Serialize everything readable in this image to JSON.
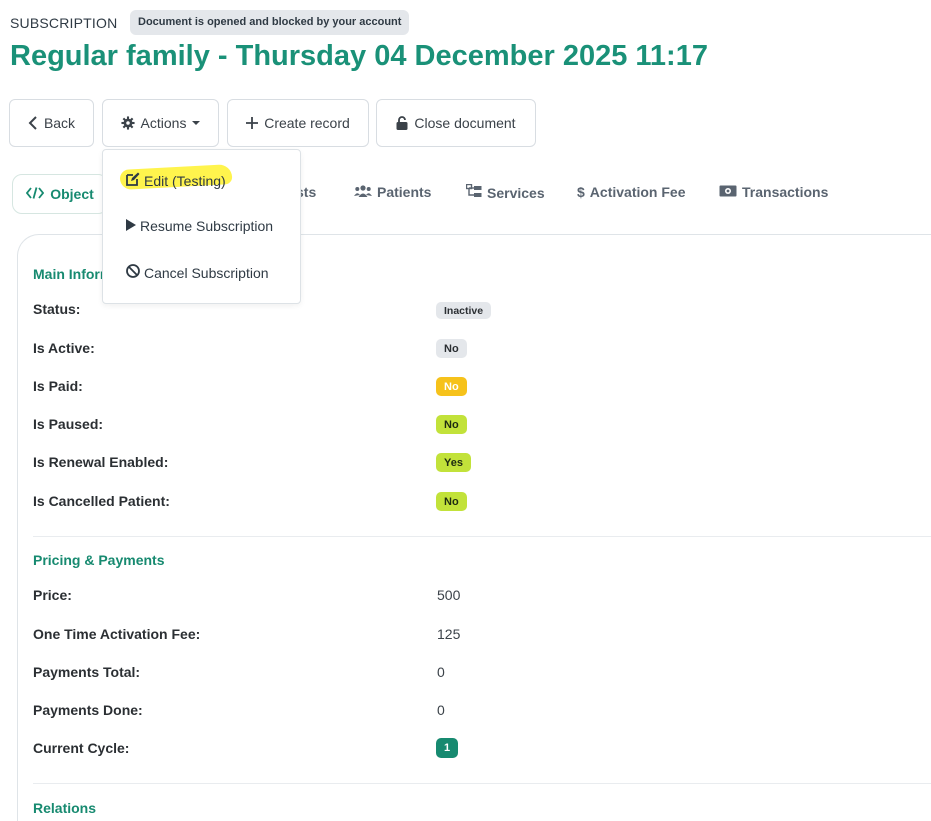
{
  "header": {
    "doc_type": "SUBSCRIPTION",
    "lock_badge": "Document is opened and blocked by your account",
    "title": "Regular family - Thursday 04 December 2025 11:17"
  },
  "toolbar": {
    "back_label": "Back",
    "actions_label": "Actions",
    "create_label": "Create record",
    "close_label": "Close document"
  },
  "actions_menu": {
    "items": [
      {
        "label": "Edit (Testing)",
        "icon": "edit-icon"
      },
      {
        "label": "Resume Subscription",
        "icon": "play-icon"
      },
      {
        "label": "Cancel Subscription",
        "icon": "ban-icon"
      }
    ]
  },
  "tabs": {
    "object": "Object",
    "lists_partial": "sts",
    "patients": "Patients",
    "services": "Services",
    "activation_fee": "Activation Fee",
    "transactions": "Transactions"
  },
  "main_info": {
    "title_partial": "Main Inforn",
    "rows": [
      {
        "label": "Status:",
        "value": "Inactive"
      },
      {
        "label": "Is Active:",
        "value": "No"
      },
      {
        "label": "Is Paid:",
        "value": "No"
      },
      {
        "label": "Is Paused:",
        "value": "No"
      },
      {
        "label": "Is Renewal Enabled:",
        "value": "Yes"
      },
      {
        "label": "Is Cancelled Patient:",
        "value": "No"
      }
    ]
  },
  "pricing": {
    "title": "Pricing & Payments",
    "rows": [
      {
        "label": "Price:",
        "value": "500"
      },
      {
        "label": "One Time Activation Fee:",
        "value": "125"
      },
      {
        "label": "Payments Total:",
        "value": "0"
      },
      {
        "label": "Payments Done:",
        "value": "0"
      },
      {
        "label": "Current Cycle:",
        "value": "1"
      }
    ]
  },
  "relations": {
    "title": "Relations"
  },
  "colors": {
    "accent": "#1a9178",
    "badge_yellow": "#f6c21b",
    "badge_lime": "#c2e23a",
    "badge_grey": "#e4e7eb",
    "highlight": "#fff33a"
  }
}
